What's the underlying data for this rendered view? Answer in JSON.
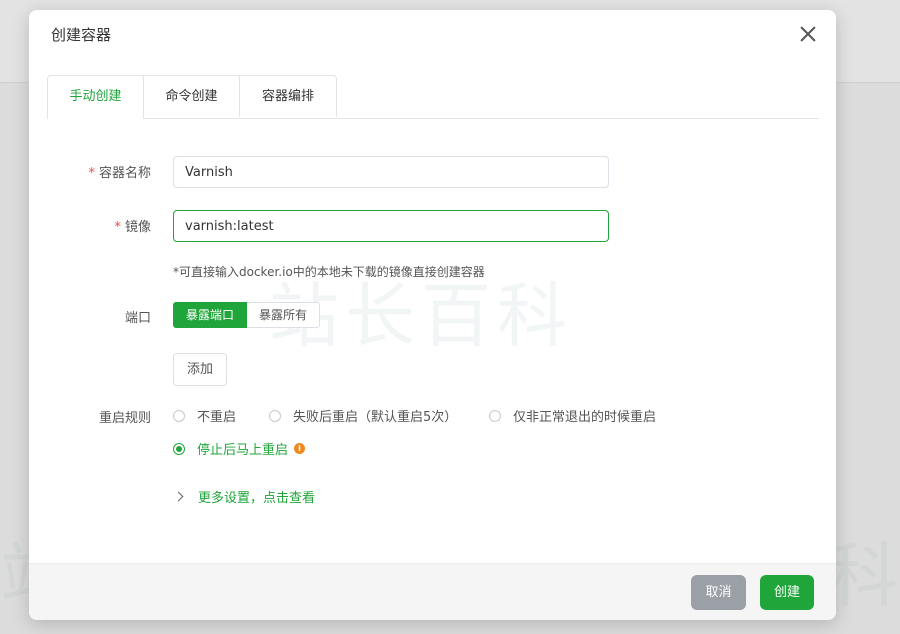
{
  "dialog": {
    "title": "创建容器"
  },
  "tabs": [
    {
      "label": "手动创建",
      "active": true
    },
    {
      "label": "命令创建",
      "active": false
    },
    {
      "label": "容器编排",
      "active": false
    }
  ],
  "form": {
    "name": {
      "label": "容器名称",
      "required": true,
      "value": "Varnish"
    },
    "image": {
      "label": "镜像",
      "required": true,
      "value": "varnish:latest",
      "hint": "*可直接输入docker.io中的本地未下载的镜像直接创建容器"
    },
    "port": {
      "label": "端口",
      "options": [
        "暴露端口",
        "暴露所有"
      ],
      "selected": "暴露端口",
      "add_label": "添加"
    },
    "restart": {
      "label": "重启规则",
      "options": [
        "不重启",
        "失败后重启（默认重启5次）",
        "仅非正常退出的时候重启",
        "停止后马上重启"
      ],
      "selected": "停止后马上重启"
    },
    "more_label": "更多设置，点击查看"
  },
  "footer": {
    "cancel_label": "取消",
    "create_label": "创建"
  },
  "watermark": "站长百科",
  "colors": {
    "accent": "#20a53a",
    "required": "#e94b4b",
    "info": "#f0891f"
  }
}
